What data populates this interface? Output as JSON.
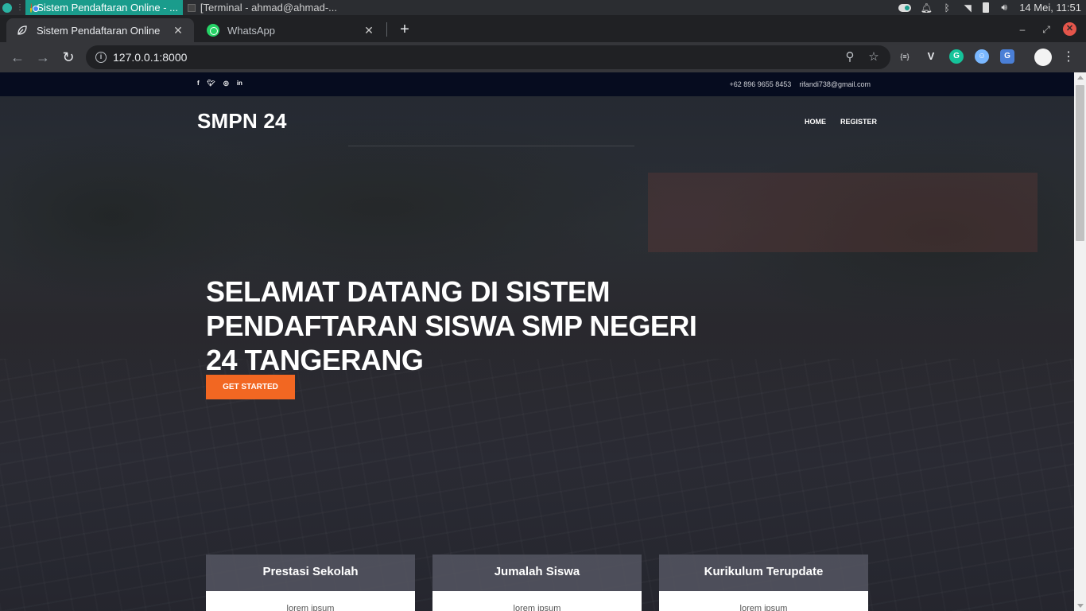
{
  "os": {
    "tasks": [
      {
        "label": "Sistem Pendaftaran Online - ...",
        "active": true
      },
      {
        "label": "[Terminal - ahmad@ahmad-...",
        "active": false
      }
    ],
    "clock": "14 Mei, 11:51"
  },
  "browser": {
    "tabs": [
      {
        "title": "Sistem Pendaftaran Online",
        "active": true
      },
      {
        "title": "WhatsApp",
        "active": false
      }
    ],
    "url": "127.0.0.1:8000",
    "extensions": [
      "{≡}",
      "V",
      "G",
      "☺",
      "G"
    ]
  },
  "site": {
    "topbar": {
      "social_icons": [
        "facebook-icon",
        "twitter-icon",
        "instagram-icon",
        "linkedin-icon"
      ],
      "phone": "+62 896 9655 8453",
      "email": "rifandi738@gmail.com"
    },
    "brand": "SMPN 24",
    "nav": [
      "HOME",
      "REGISTER"
    ],
    "hero": {
      "headline": "SELAMAT DATANG DI SISTEM PENDAFTARAN SISWA SMP NEGERI 24 TANGERANG",
      "cta": "GET STARTED"
    },
    "cards": [
      {
        "title": "Prestasi Sekolah",
        "body": "lorem ipsum"
      },
      {
        "title": "Jumalah Siswa",
        "body": "lorem ipsum"
      },
      {
        "title": "Kurikulum Terupdate",
        "body": "lorem ipsum"
      }
    ]
  },
  "colors": {
    "accent": "#f26722",
    "topbar_bg": "#060c1f",
    "os_active_task": "#1a9c8c"
  }
}
